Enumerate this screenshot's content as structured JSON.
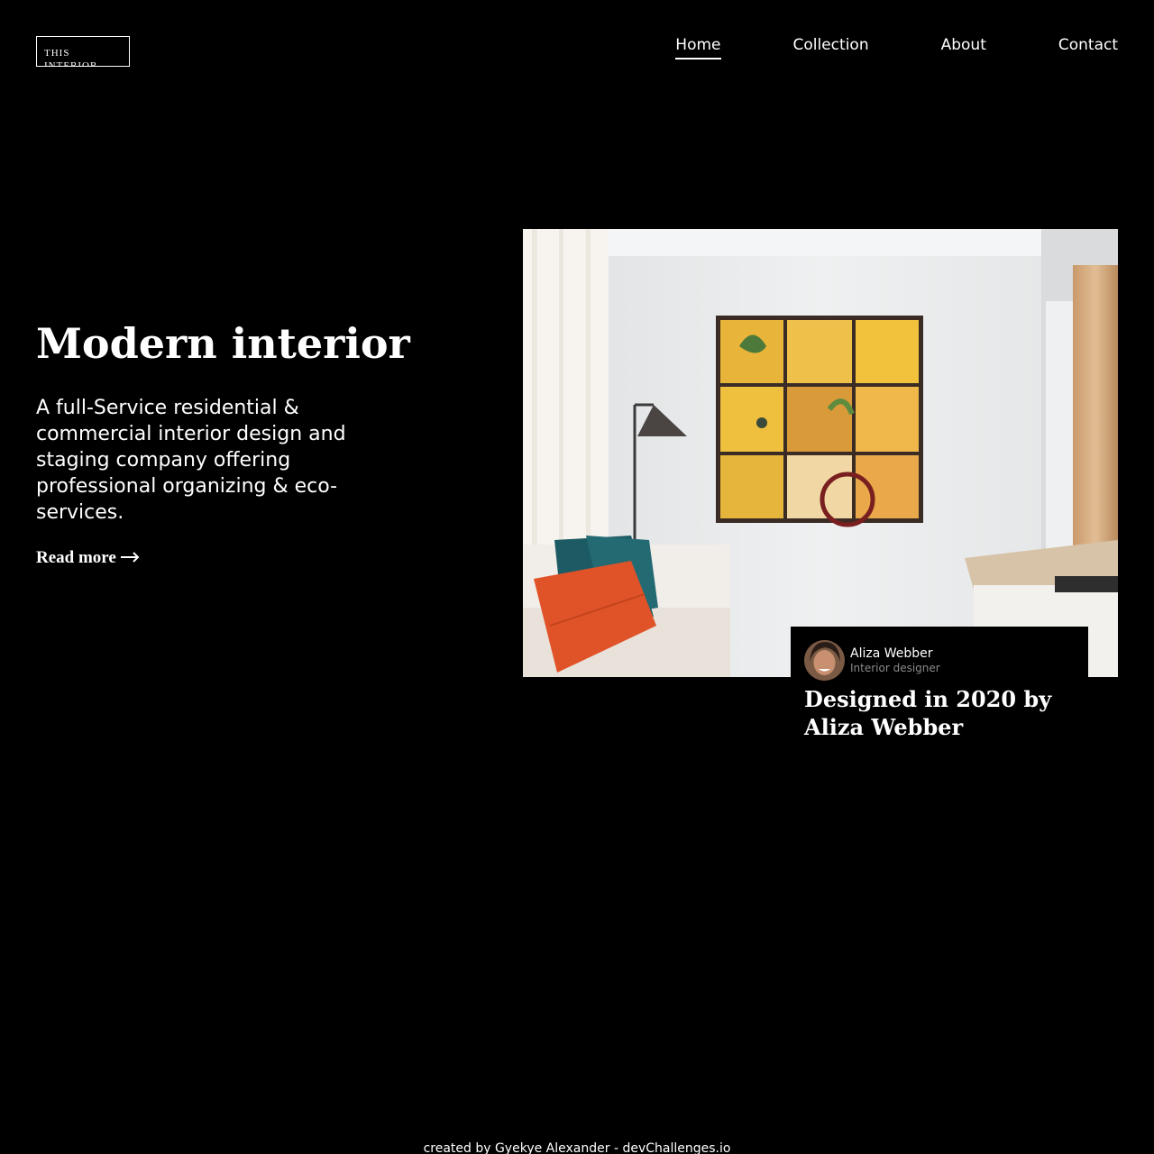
{
  "header": {
    "logo_text": "THIS INTERIOR",
    "nav": [
      {
        "label": "Home",
        "active": true
      },
      {
        "label": "Collection",
        "active": false
      },
      {
        "label": "About",
        "active": false
      },
      {
        "label": "Contact",
        "active": false
      }
    ]
  },
  "hero": {
    "title": "Modern interior",
    "description": "A full-Service residential & commercial interior design and staging company offering professional organizing & eco-services.",
    "read_more": "Read more",
    "read_more_icon": "arrow-right-icon",
    "image_alt": "living room with yellow framed wall art"
  },
  "card": {
    "designer_name": "Aliza Webber",
    "designer_role": "Interior designer",
    "title": "Designed in 2020 by Aliza Webber"
  },
  "footer": {
    "credit": "created by Gyekye Alexander - devChallenges.io"
  },
  "colors": {
    "background": "#000000",
    "text": "#ffffff",
    "muted": "#8a8a8a"
  }
}
